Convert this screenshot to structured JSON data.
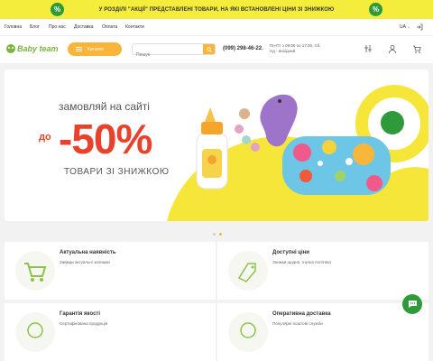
{
  "promo": {
    "badge": "%",
    "text": "У РОЗДІЛІ \"АКЦІЇ\" ПРЕДСТАВЛЕНІ ТОВАРИ, НА ЯКІ ВСТАНОВЛЕНІ ЦІНИ ЗІ ЗНИЖКОЮ"
  },
  "topnav": {
    "links": [
      "Головна",
      "Блог",
      "Про нас",
      "Доставка",
      "Оплата",
      "Контакти"
    ],
    "lang": "UA"
  },
  "header": {
    "logo": "Baby team",
    "catalog_label": "Каталог",
    "search_placeholder": "Пошук",
    "phone": "(099) 298-46-22",
    "hours": "Пн-Пт з 09:00 по 17:00, Сб, Нд - вихідний"
  },
  "hero": {
    "title": "замовляй на сайті",
    "prefix": "до",
    "percent": "-50%",
    "subtitle": "ТОВАРИ ЗІ ЗНИЖКОЮ",
    "slide_count": 2,
    "active_slide": 2
  },
  "features": [
    {
      "title": "Актуальна наявність",
      "desc": "Завжди актуальні залишки"
    },
    {
      "title": "Доступні ціни",
      "desc": "Знижки щодня, гнучка політика"
    },
    {
      "title": "Гарантія якості",
      "desc": "Сертифікована продукція"
    },
    {
      "title": "Оперативна доставка",
      "desc": "Популярні поштові служби"
    }
  ],
  "colors": {
    "promo_bg": "#f4ed3b",
    "accent": "#f9b43a",
    "brand_green": "#2e9a3a",
    "sale_red": "#e8412c"
  }
}
